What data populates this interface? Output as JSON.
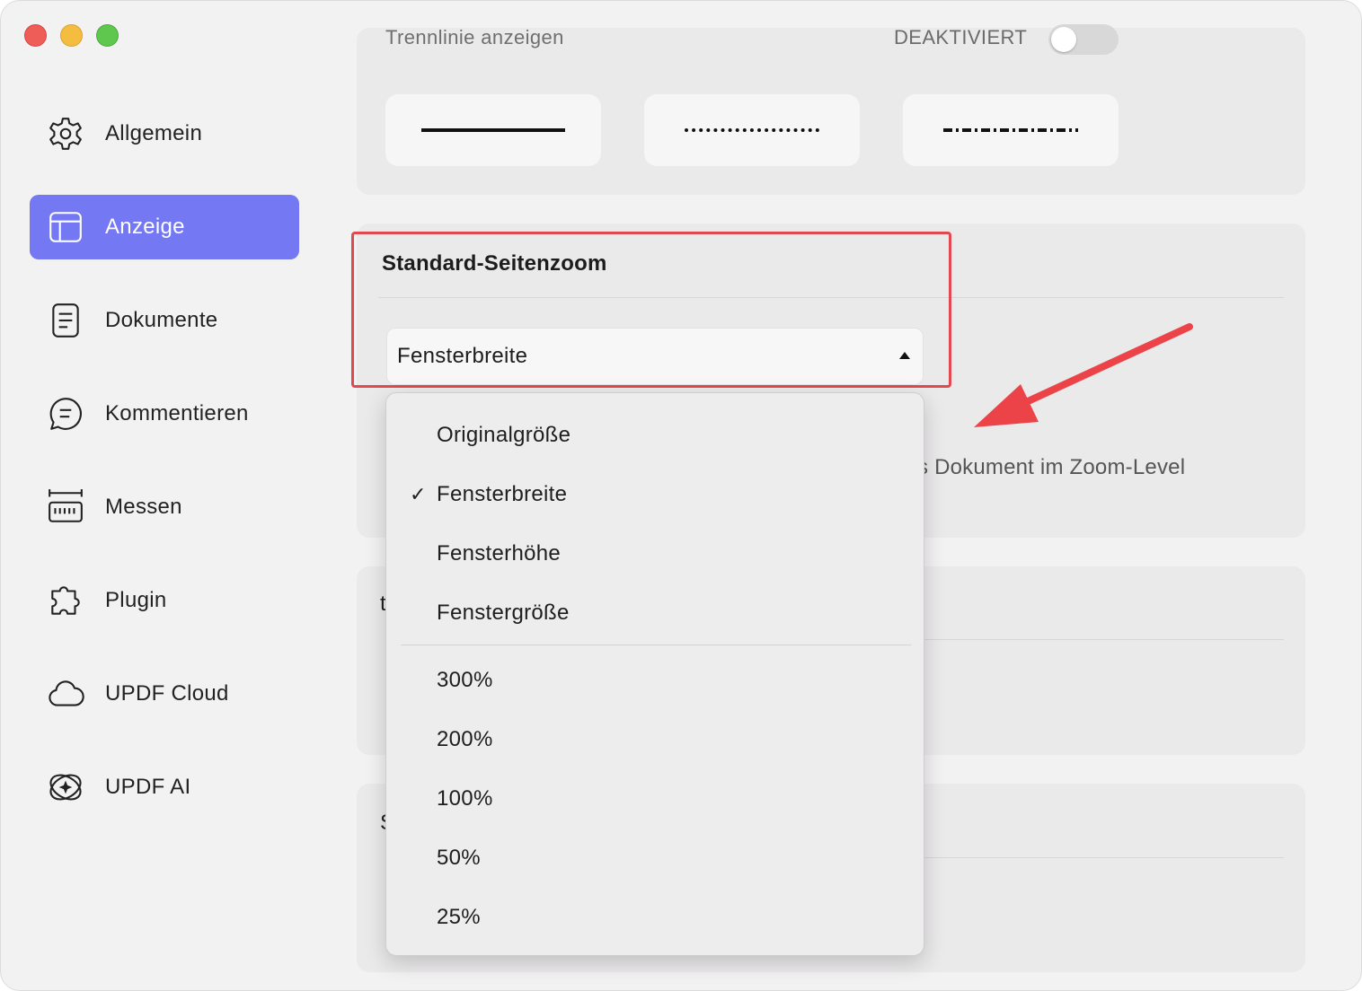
{
  "sidebar": {
    "items": [
      {
        "label": "Allgemein",
        "icon": "gear-icon"
      },
      {
        "label": "Anzeige",
        "icon": "layout-icon",
        "active": true
      },
      {
        "label": "Dokumente",
        "icon": "document-icon"
      },
      {
        "label": "Kommentieren",
        "icon": "comment-icon"
      },
      {
        "label": "Messen",
        "icon": "ruler-icon"
      },
      {
        "label": "Plugin",
        "icon": "puzzle-icon"
      },
      {
        "label": "UPDF Cloud",
        "icon": "cloud-icon"
      },
      {
        "label": "UPDF AI",
        "icon": "ai-icon"
      }
    ]
  },
  "separator_section": {
    "label": "Trennlinie anzeigen",
    "toggle_label": "DEAKTIVIERT",
    "toggle_on": false
  },
  "zoom_section": {
    "title": "Standard-Seitenzoom",
    "selected": "Fensterbreite",
    "helper_text": "s Dokument im Zoom-Level"
  },
  "dropdown": {
    "options": [
      {
        "label": "Originalgröße",
        "checked": false
      },
      {
        "label": "Fensterbreite",
        "checked": true
      },
      {
        "label": "Fensterhöhe",
        "checked": false
      },
      {
        "label": "Fenstergröße",
        "checked": false
      }
    ],
    "percent_options": [
      "300%",
      "200%",
      "100%",
      "50%",
      "25%"
    ],
    "check_glyph": "✓"
  },
  "partial_labels": {
    "card3": "t",
    "card4": "S"
  },
  "colors": {
    "accent": "#7478f2",
    "highlight": "#e2484f",
    "arrow": "#ec4349"
  }
}
